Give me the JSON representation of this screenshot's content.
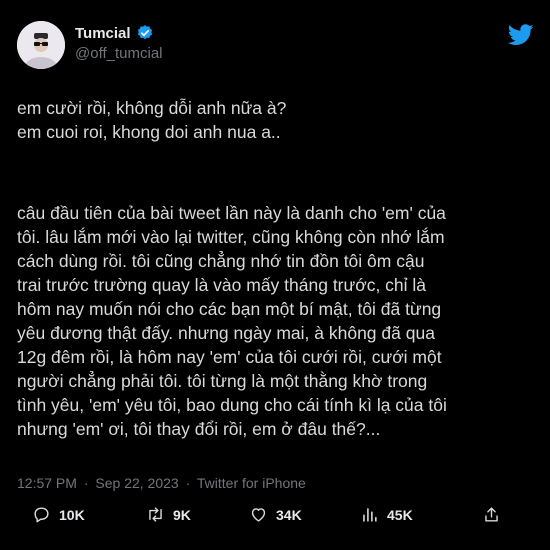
{
  "author": {
    "display_name": "Tumcial",
    "handle": "@off_tumcial",
    "verified_icon": "verified-badge-icon",
    "avatar_icon": "avatar-photo"
  },
  "brand": {
    "icon": "twitter-bird-icon",
    "color": "#1d9bf0"
  },
  "tweet": {
    "paragraph1": [
      "em cười rồi, không dỗi anh nữa à?",
      "em cuoi roi, khong doi anh nua a.."
    ],
    "paragraph2": [
      "câu đầu tiên của bài tweet lần này là danh cho 'em' của",
      "tôi. lâu lắm mới vào lại twitter, cũng không còn nhớ lắm",
      "cách dùng rồi. tôi cũng chẳng nhớ tin đồn tôi ôm cậu",
      "trai trước trường quay là vào mấy tháng trước, chỉ là",
      "hôm nay muốn nói cho các bạn một bí mật, tôi đã từng",
      "yêu đương thật đấy. nhưng ngày mai, à không đã qua",
      "12g đêm rồi, là hôm nay 'em' của tôi cưới rồi, cưới một",
      "người chẳng phải tôi. tôi từng là một thằng khờ trong",
      "tình yêu, 'em' yêu tôi, bao dung cho cái tính kì lạ của tôi",
      "nhưng 'em' ơi, tôi thay đổi rồi, em ở đâu thế?..."
    ]
  },
  "meta": {
    "time": "12:57 PM",
    "sep1": "·",
    "date": "Sep 22, 2023",
    "sep2": "·",
    "source": "Twitter for iPhone"
  },
  "actions": {
    "replies": "10K",
    "retweets": "9K",
    "likes": "34K",
    "views": "45K"
  }
}
